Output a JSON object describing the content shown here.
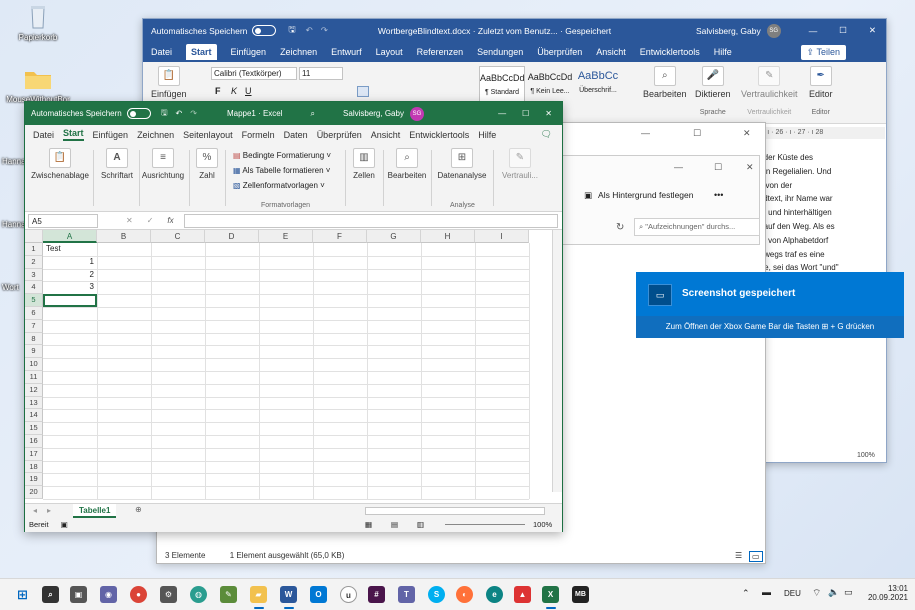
{
  "desktop": {
    "recycle_bin": "Papierkorb",
    "folder": "MouseWithoutBor",
    "partial1": "Hanna",
    "partial2": "Hanna",
    "partial3": "Wort"
  },
  "word": {
    "autosave": "Automatisches Speichern",
    "title": "WortbergeBlindtext.docx · Zuletzt vom Benutz...  ·  Gespeichert",
    "user": "Salvisberg, Gaby",
    "initials": "SG",
    "tabs": [
      "Datei",
      "Start",
      "Einfügen",
      "Zeichnen",
      "Entwurf",
      "Layout",
      "Referenzen",
      "Sendungen",
      "Überprüfen",
      "Ansicht",
      "Entwicklertools",
      "Hilfe"
    ],
    "share": "Teilen",
    "paste": "Einfügen",
    "font_name": "Calibri (Textkörper)",
    "font_size": "11",
    "styles": [
      {
        "preview": "AaBbCcDd",
        "name": "¶ Standard"
      },
      {
        "preview": "AaBbCcDd",
        "name": "¶ Kein Lee..."
      },
      {
        "preview": "AaBbCc",
        "name": "Überschrif..."
      }
    ],
    "edit": "Bearbeiten",
    "dictate": "Diktieren",
    "sensitivity": "Vertraulichkeit",
    "editor": "Editor",
    "group_speech": "Sprache",
    "group_sens": "Vertraulichkeit",
    "group_editor": "Editor",
    "ruler": "· 25 · ı · 26 · ı · 27 · ı 28",
    "doc_lines": [
      "n der Küste des",
      "gen Regelialien. Und",
      "al von der",
      "indtext, ihr Name war",
      "en und hinterhältigen",
      "n auf den Weg. Als es",
      "ne von Alphabetdorf",
      "erwegs traf es eine",
      "äre, sei das Wort \"und\""
    ],
    "zoom": "100%"
  },
  "explorer": {
    "status_count": "3 Elemente",
    "status_selected": "1 Element ausgewählt (65,0 KB)",
    "search_placeholder": "\"Aufzeichnungen\" durchs...",
    "background_btn": "Als Hintergrund festlegen",
    "more": "•••"
  },
  "excel": {
    "autosave": "Automatisches Speichern",
    "title": "Mappe1  ·  Excel",
    "user": "Salvisberg, Gaby",
    "initials": "SG",
    "tabs": [
      "Datei",
      "Start",
      "Einfügen",
      "Zeichnen",
      "Seitenlayout",
      "Formeln",
      "Daten",
      "Überprüfen",
      "Ansicht",
      "Entwicklertools",
      "Hilfe"
    ],
    "ribbon": {
      "clipboard": "Zwischenablage",
      "font": "Schriftart",
      "alignment": "Ausrichtung",
      "number": "Zahl",
      "cond_format": "Bedingte Formatierung",
      "as_table": "Als Tabelle formatieren",
      "cell_styles": "Zellenformatvorlagen",
      "styles_group": "Formatvorlagen",
      "cells": "Zellen",
      "editing": "Bearbeiten",
      "analysis": "Datenanalyse",
      "analysis_group": "Analyse",
      "sensitivity": "Vertrauli..."
    },
    "namebox": "A5",
    "fx": "fx",
    "columns": [
      "A",
      "B",
      "C",
      "D",
      "E",
      "F",
      "G",
      "H",
      "I"
    ],
    "rows": [
      "1",
      "2",
      "3",
      "4",
      "5",
      "6",
      "7",
      "8",
      "9",
      "10",
      "11",
      "12",
      "13",
      "14",
      "15",
      "16",
      "17",
      "18",
      "19",
      "20"
    ],
    "cells": {
      "A1": "Test",
      "A2": "1",
      "A3": "2",
      "A4": "3"
    },
    "sheet_tab": "Tabelle1",
    "status": "Bereit",
    "zoom": "100%"
  },
  "toast": {
    "title": "Screenshot gespeichert",
    "body": "Zum Öffnen der Xbox Game Bar die Tasten ⊞ + G drücken"
  },
  "taskbar": {
    "lang": "DEU",
    "time": "13:01",
    "date": "20.09.2021"
  },
  "colors": {
    "word_blue": "#2b579a",
    "excel_green": "#217346",
    "toast_blue": "#0078d4"
  }
}
